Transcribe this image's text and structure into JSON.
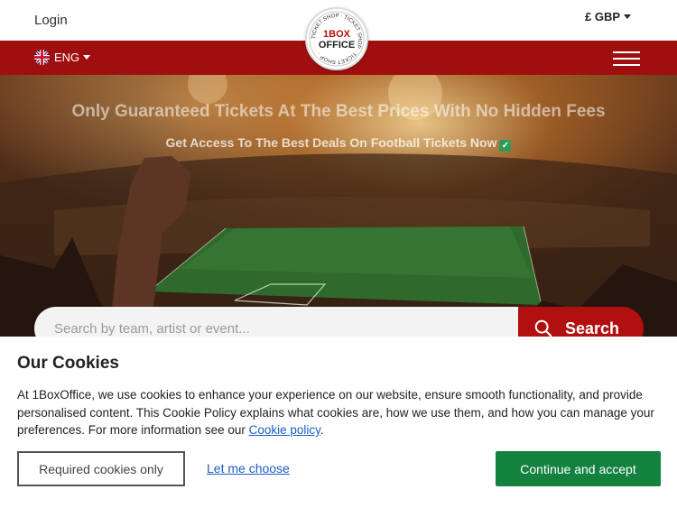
{
  "header": {
    "login_label": "Login",
    "currency_label": "£ GBP",
    "language_label": "ENG",
    "logo": {
      "ring_text": "TICKET SHOP · TICKET SHOP · TICKET SHOP ·",
      "line1": "1BOX",
      "line2": "OFFICE"
    }
  },
  "hero": {
    "title": "Only Guaranteed Tickets At The Best Prices With No Hidden Fees",
    "subtitle": "Get Access To The Best Deals On Football Tickets Now"
  },
  "search": {
    "placeholder": "Search by team, artist or event...",
    "button_label": "Search"
  },
  "cookie_banner": {
    "title": "Our Cookies",
    "body_text": "At 1BoxOffice, we use cookies to enhance your experience on our website, ensure smooth functionality, and provide personalised content. This Cookie Policy explains what cookies are, how we use them, and how you can manage your preferences. For more information see our ",
    "policy_link": "Cookie policy",
    "body_end": ".",
    "required_button": "Required cookies only",
    "choose_link": "Let me choose",
    "accept_button": "Continue and accept"
  },
  "colors": {
    "brand_red": "#a00f0f",
    "search_red": "#b21010",
    "accept_green": "#13823f",
    "link_blue": "#1a5ec2"
  }
}
